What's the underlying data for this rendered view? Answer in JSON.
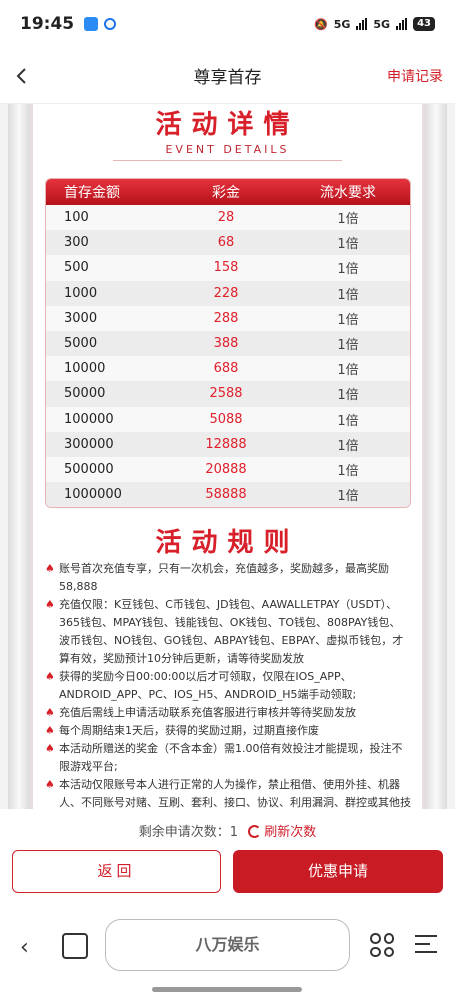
{
  "status": {
    "time": "19:45",
    "signal1": "5G",
    "signal2": "5G",
    "battery": "43"
  },
  "header": {
    "title": "尊享首存",
    "records_label": "申请记录"
  },
  "event": {
    "title": "活动详情",
    "subtitle": "EVENT DETAILS",
    "table": {
      "headers": [
        "首存金额",
        "彩金",
        "流水要求"
      ],
      "rows": [
        [
          "100",
          "28",
          "1倍"
        ],
        [
          "300",
          "68",
          "1倍"
        ],
        [
          "500",
          "158",
          "1倍"
        ],
        [
          "1000",
          "228",
          "1倍"
        ],
        [
          "3000",
          "288",
          "1倍"
        ],
        [
          "5000",
          "388",
          "1倍"
        ],
        [
          "10000",
          "688",
          "1倍"
        ],
        [
          "50000",
          "2588",
          "1倍"
        ],
        [
          "100000",
          "5088",
          "1倍"
        ],
        [
          "300000",
          "12888",
          "1倍"
        ],
        [
          "500000",
          "20888",
          "1倍"
        ],
        [
          "1000000",
          "58888",
          "1倍"
        ]
      ]
    }
  },
  "rules": {
    "title": "活动规则",
    "items": [
      "账号首次充值专享，只有一次机会，充值越多，奖励越多，最高奖励58,888",
      "充值仅限：K豆钱包、C币钱包、JD钱包、AAWALLETPAY（USDT）、365钱包、MPAY钱包、钱能钱包、OK钱包、TO钱包、808PAY钱包、波币钱包、NO钱包、GO钱包、ABPAY钱包、EBPAY、虚拟币钱包，才算有效，奖励预计10分钟后更新，请等待奖励发放",
      "获得的奖励今日00:00:00以后才可领取，仅限在IOS_APP、ANDROID_APP、PC、IOS_H5、ANDROID_H5端手动领取;",
      "充值后需线上申请活动联系充值客服进行审核并等待奖励发放",
      "每个周期结束1天后，获得的奖励过期，过期直接作废",
      "本活动所赠送的奖金（不含本金）需1.00倍有效投注才能提现，投注不限游戏平台;",
      "本活动仅限账号本人进行正常的人为操作，禁止租借、使用外挂、机器人、不同账号对赌、互刷、套利、接口、协议、利用漏洞、群控或其他技术手段参与，否则将取消或扣除奖励、冻结、甚至加入黑名单;"
    ]
  },
  "footer": {
    "remain_label": "剩余申请次数：",
    "remain_count": "1",
    "refresh_label": "刷新次数",
    "back_label": "返回",
    "apply_label": "优惠申请"
  },
  "browser": {
    "url_text": "八万娱乐"
  }
}
